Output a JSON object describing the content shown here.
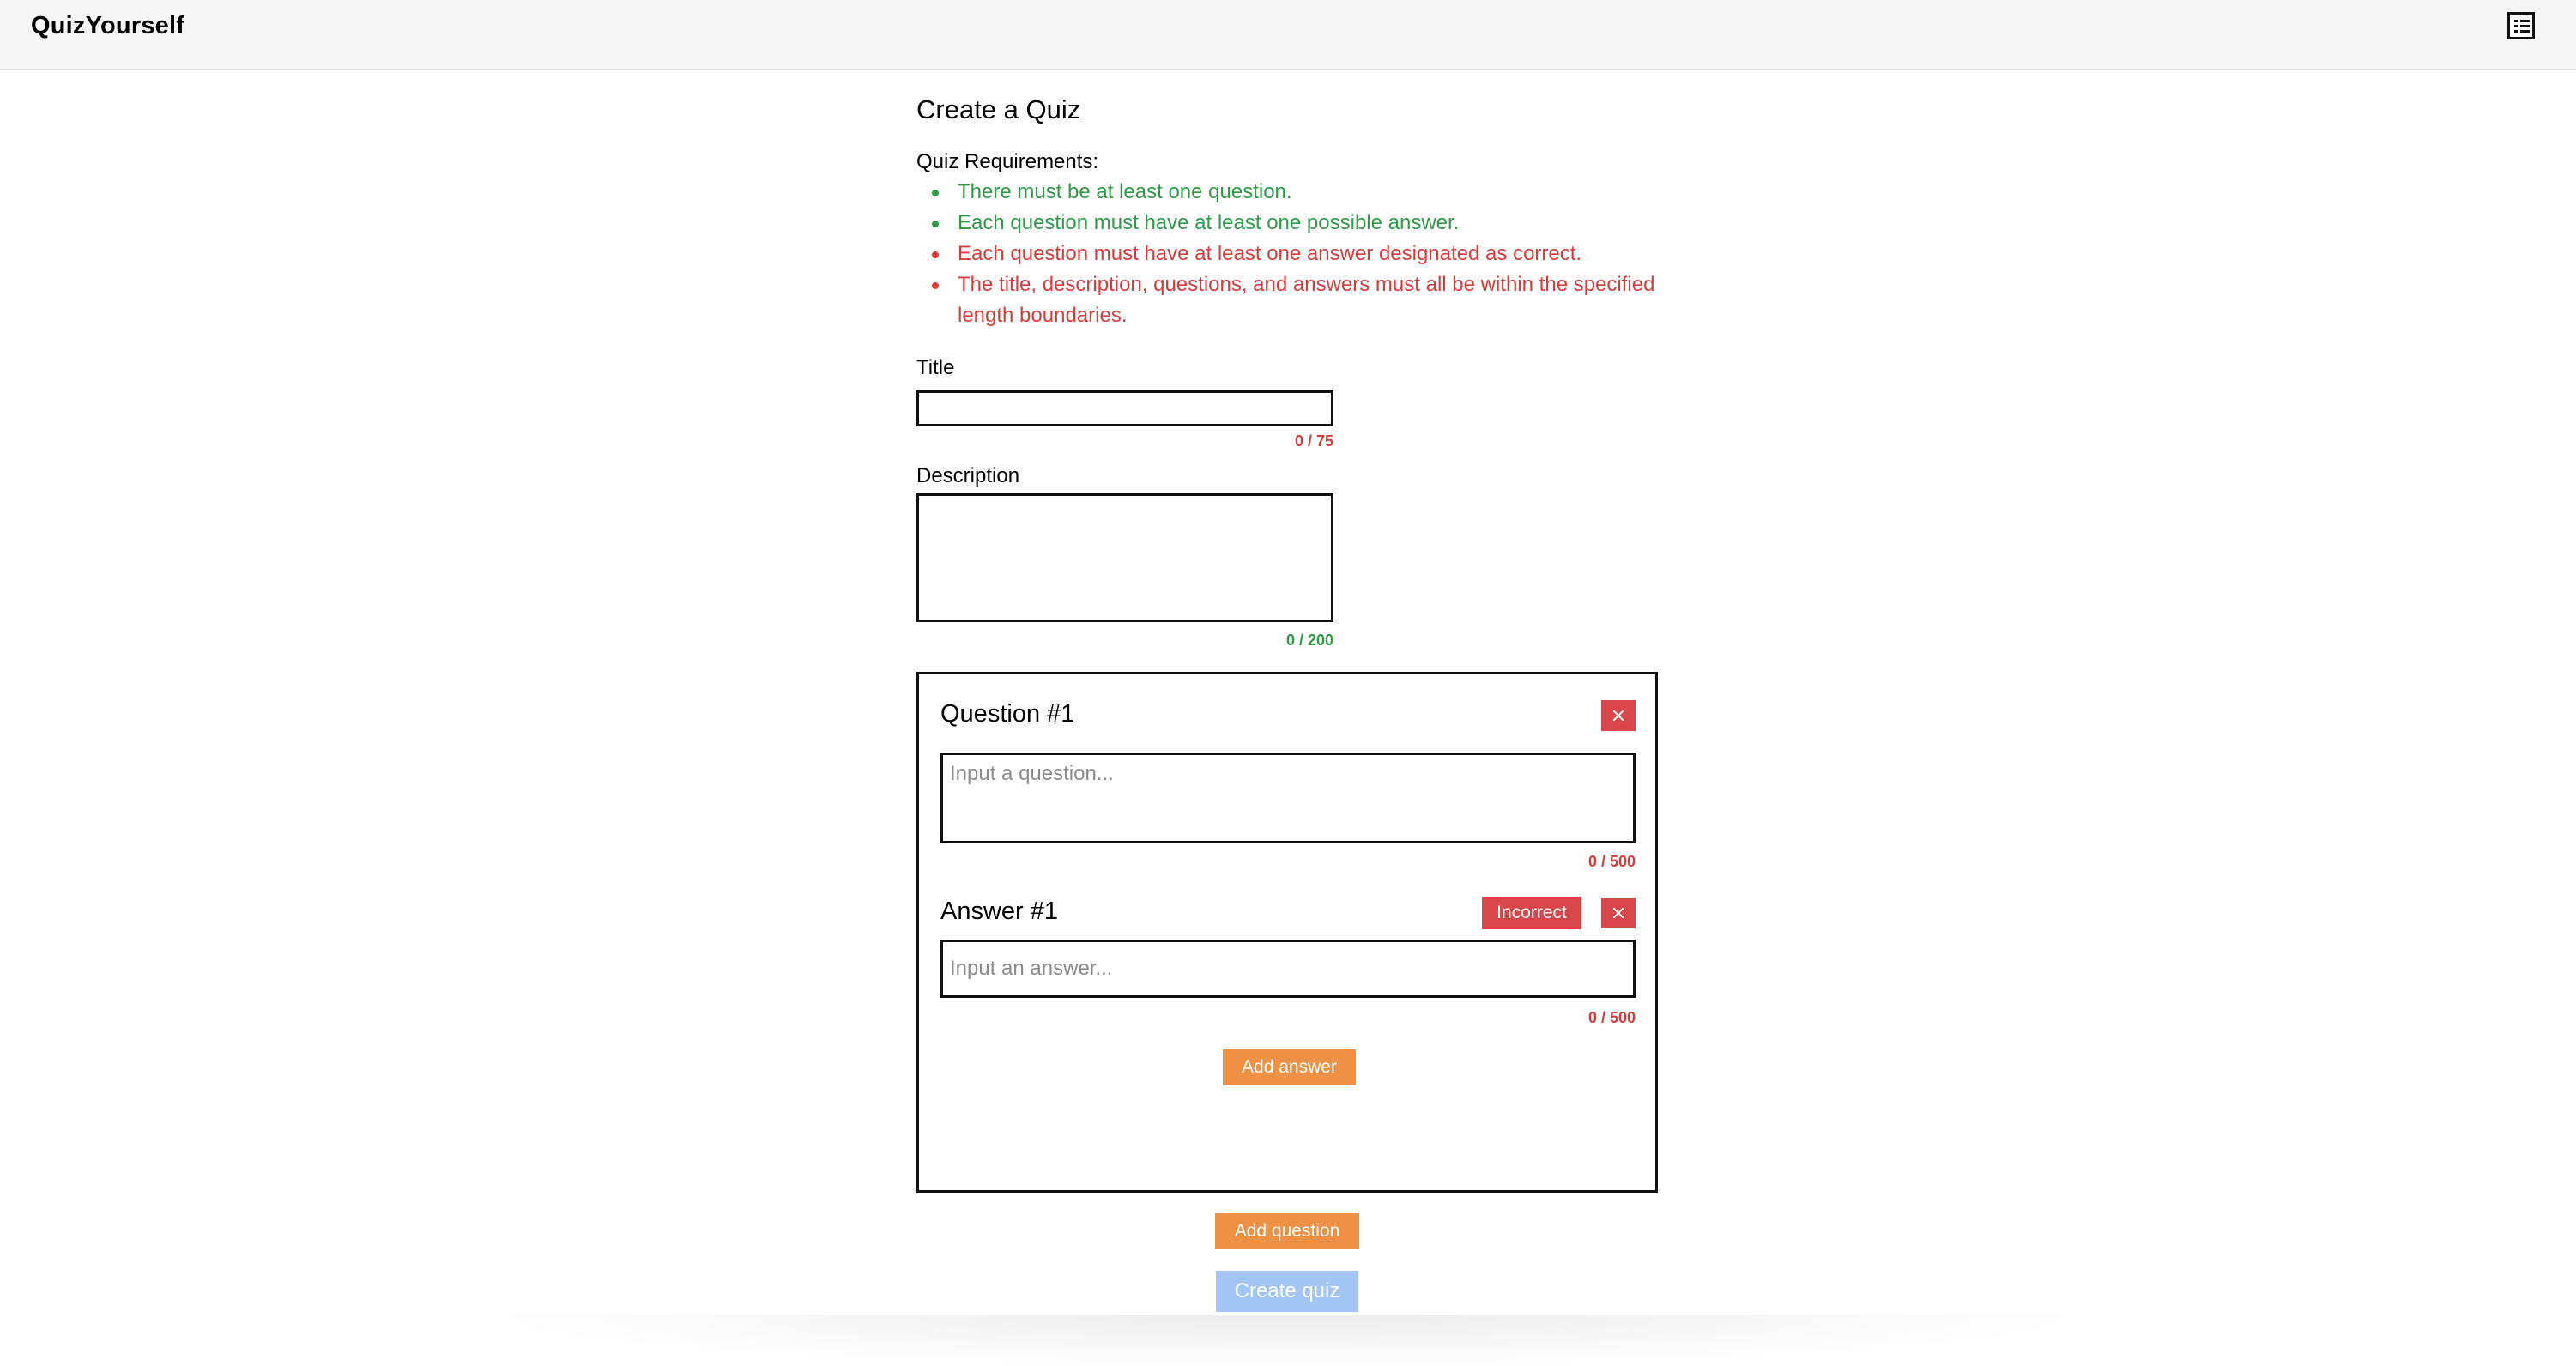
{
  "app": {
    "brand": "QuizYourself",
    "menu_icon": "list-icon"
  },
  "page": {
    "title": "Create a Quiz",
    "requirements_label": "Quiz Requirements:",
    "requirements": [
      {
        "text": "There must be at least one question.",
        "status": "met"
      },
      {
        "text": "Each question must have at least one possible answer.",
        "status": "met"
      },
      {
        "text": "Each question must have at least one answer designated as correct.",
        "status": "unmet"
      },
      {
        "text": "The title, description, questions, and answers must all be within the specified length boundaries.",
        "status": "unmet"
      }
    ]
  },
  "form": {
    "title_label": "Title",
    "title_value": "",
    "title_counter": "0 / 75",
    "description_label": "Description",
    "description_value": "",
    "description_counter": "0 / 200"
  },
  "question": {
    "heading": "Question #1",
    "placeholder": "Input a question...",
    "value": "",
    "counter": "0 / 500",
    "answer": {
      "heading": "Answer #1",
      "correctness_label": "Incorrect",
      "placeholder": "Input an answer...",
      "value": "",
      "counter": "0 / 500"
    },
    "add_answer_label": "Add answer"
  },
  "actions": {
    "add_question_label": "Add question",
    "create_quiz_label": "Create quiz"
  },
  "colors": {
    "met": "#2f9a47",
    "unmet": "#d93b3b",
    "danger_button": "#d9464a",
    "accent_orange": "#ef9145",
    "disabled_blue": "#a3c5f5"
  }
}
